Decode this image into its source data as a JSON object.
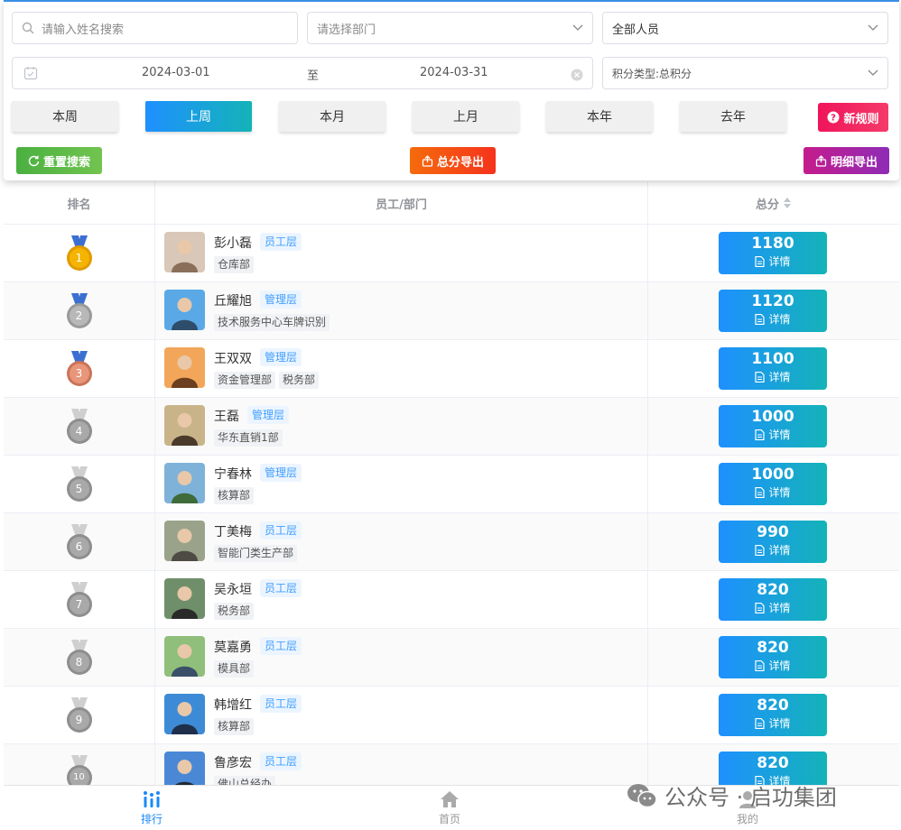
{
  "filters": {
    "search_placeholder": "请输入姓名搜索",
    "department_placeholder": "请选择部门",
    "personnel_value": "全部人员",
    "date_start": "2024-03-01",
    "date_separator": "至",
    "date_end": "2024-03-31",
    "points_type": "积分类型:总积分"
  },
  "periods": [
    {
      "label": "本周",
      "active": false
    },
    {
      "label": "上周",
      "active": true
    },
    {
      "label": "本月",
      "active": false
    },
    {
      "label": "上月",
      "active": false
    },
    {
      "label": "本年",
      "active": false
    },
    {
      "label": "去年",
      "active": false
    }
  ],
  "actions": {
    "new_rule": "新规则",
    "reset_search": "重置搜索",
    "export_total": "总分导出",
    "export_detail": "明细导出"
  },
  "colors": {
    "accent": "#1e90ff",
    "teal": "#14b3b8",
    "new_rule": "#f0145a",
    "reset": "#5bb946",
    "export_total": "#f5480e",
    "export_detail": "#9a27b0"
  },
  "table": {
    "headers": {
      "rank": "排名",
      "employee": "员工/部门",
      "score": "总分"
    },
    "detail_label": "详情",
    "rows": [
      {
        "rank": "1",
        "name": "彭小磊",
        "role": "员工层",
        "depts": [
          "仓库部"
        ],
        "score": "1180",
        "medal": "gold"
      },
      {
        "rank": "2",
        "name": "丘耀旭",
        "role": "管理层",
        "depts": [
          "技术服务中心车牌识别"
        ],
        "score": "1120",
        "medal": "silver"
      },
      {
        "rank": "3",
        "name": "王双双",
        "role": "管理层",
        "depts": [
          "资金管理部",
          "税务部"
        ],
        "score": "1100",
        "medal": "bronze"
      },
      {
        "rank": "4",
        "name": "王磊",
        "role": "管理层",
        "depts": [
          "华东直销1部"
        ],
        "score": "1000",
        "medal": "grey"
      },
      {
        "rank": "5",
        "name": "宁春林",
        "role": "管理层",
        "depts": [
          "核算部"
        ],
        "score": "1000",
        "medal": "grey"
      },
      {
        "rank": "6",
        "name": "丁美梅",
        "role": "员工层",
        "depts": [
          "智能门类生产部"
        ],
        "score": "990",
        "medal": "grey"
      },
      {
        "rank": "7",
        "name": "吴永垣",
        "role": "员工层",
        "depts": [
          "税务部"
        ],
        "score": "820",
        "medal": "grey"
      },
      {
        "rank": "8",
        "name": "莫嘉勇",
        "role": "员工层",
        "depts": [
          "模具部"
        ],
        "score": "820",
        "medal": "grey"
      },
      {
        "rank": "9",
        "name": "韩增红",
        "role": "员工层",
        "depts": [
          "核算部"
        ],
        "score": "820",
        "medal": "grey"
      },
      {
        "rank": "10",
        "name": "鲁彦宏",
        "role": "员工层",
        "depts": [
          "佛山总经办"
        ],
        "score": "820",
        "medal": "grey"
      }
    ]
  },
  "nav": {
    "ranking": "排行",
    "home": "首页",
    "mine": "我的"
  },
  "watermark": {
    "text": "公众号 · 启功集团"
  }
}
